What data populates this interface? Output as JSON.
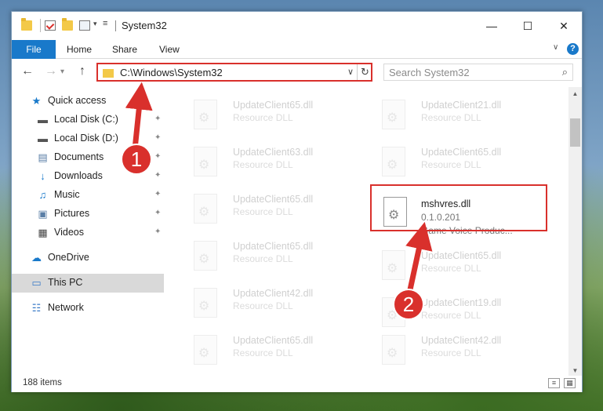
{
  "window": {
    "title": "System32",
    "controls": {
      "minimize": "—",
      "maximize": "☐",
      "close": "✕"
    }
  },
  "ribbon": {
    "tabs": [
      "File",
      "Home",
      "Share",
      "View"
    ],
    "chevron": "∨",
    "help": "?"
  },
  "nav": {
    "back": "←",
    "forward": "→",
    "up": "↑",
    "address": "C:\\Windows\\System32",
    "address_dropdown": "∨",
    "refresh": "↻",
    "search_placeholder": "Search System32",
    "search_icon": "⌕"
  },
  "sidebar": {
    "items": [
      {
        "label": "Quick access",
        "icon": "star-icon",
        "glyph": "★",
        "color": "#1979ca",
        "pinned": false
      },
      {
        "label": "Local Disk (C:)",
        "icon": "drive-icon",
        "glyph": "▬",
        "color": "#555555",
        "pinned": true
      },
      {
        "label": "Local Disk (D:)",
        "icon": "drive-icon",
        "glyph": "▬",
        "color": "#555555",
        "pinned": true
      },
      {
        "label": "Documents",
        "icon": "documents-icon",
        "glyph": "▤",
        "color": "#5a7ea6",
        "pinned": true
      },
      {
        "label": "Downloads",
        "icon": "download-icon",
        "glyph": "↓",
        "color": "#1979ca",
        "pinned": true
      },
      {
        "label": "Music",
        "icon": "music-icon",
        "glyph": "♫",
        "color": "#1979ca",
        "pinned": true
      },
      {
        "label": "Pictures",
        "icon": "pictures-icon",
        "glyph": "▣",
        "color": "#5a7ea6",
        "pinned": true
      },
      {
        "label": "Videos",
        "icon": "videos-icon",
        "glyph": "▦",
        "color": "#444444",
        "pinned": true
      },
      {
        "label": "OneDrive",
        "icon": "cloud-icon",
        "glyph": "☁",
        "color": "#1979ca",
        "pinned": false
      },
      {
        "label": "This PC",
        "icon": "computer-icon",
        "glyph": "▭",
        "color": "#3a7bc8",
        "pinned": false
      },
      {
        "label": "Network",
        "icon": "network-icon",
        "glyph": "☷",
        "color": "#3a7bc8",
        "pinned": false
      }
    ],
    "pin_glyph": "📌"
  },
  "files": [
    {
      "name": "UpdateClient65.dll",
      "desc": "Resource DLL"
    },
    {
      "name": "UpdateClient21.dll",
      "desc": "Resource DLL"
    },
    {
      "name": "UpdateClient63.dll",
      "desc": "Resource DLL"
    },
    {
      "name": "UpdateClient65.dll",
      "desc": "Resource DLL"
    },
    {
      "name": "UpdateClient65.dll",
      "desc": "Resource DLL"
    },
    {
      "name": "mshvres.dll",
      "desc": "0.1.0.201",
      "line3": "Game Voice    Produc..."
    },
    {
      "name": "UpdateClient65.dll",
      "desc": "Resource DLL"
    },
    {
      "name": "UpdateClient65.dll",
      "desc": "Resource DLL"
    },
    {
      "name": "UpdateClient42.dll",
      "desc": "Resource DLL"
    },
    {
      "name": "UpdateClient19.dll",
      "desc": "Resource DLL"
    },
    {
      "name": "UpdateClient65.dll",
      "desc": "Resource DLL"
    },
    {
      "name": "UpdateClient42.dll",
      "desc": "Resource DLL"
    }
  ],
  "status": {
    "items_count": "188 items",
    "details_view": "≡",
    "tiles_view": "▦"
  },
  "annotations": {
    "badge1": "1",
    "badge2": "2",
    "color": "#d9302c"
  }
}
